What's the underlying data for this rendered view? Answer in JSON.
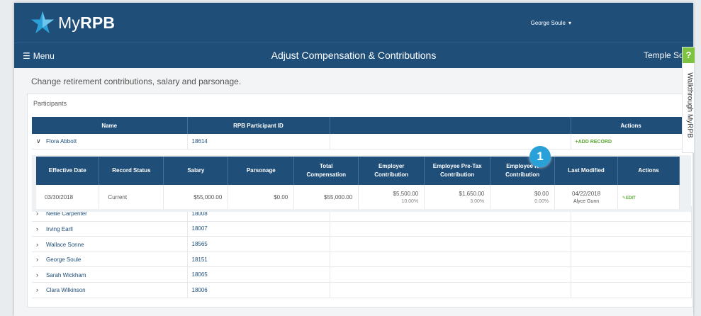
{
  "app": {
    "logo_my": "My",
    "logo_rpb": "RPB"
  },
  "user": {
    "name": "George Soule",
    "caret": "▾"
  },
  "nav": {
    "menu_icon": "☰",
    "menu_label": "Menu",
    "page_title": "Adjust Compensation & Contributions",
    "org": "Temple Solom"
  },
  "page": {
    "subtitle": "Change retirement contributions, salary and parsonage.",
    "panel_label": "Participants"
  },
  "colors": {
    "header_navy": "#1f4e79",
    "accent_green": "#5aa832",
    "badge_blue": "#2aa0d8",
    "walkthrough_green": "#7ec242"
  },
  "table": {
    "headers": {
      "name": "Name",
      "id": "RPB Participant ID",
      "blank": "",
      "actions": "Actions"
    },
    "expanded": {
      "name": "Flora Abbott",
      "id": "18614",
      "add_record": "+ADD RECORD",
      "expander": "∨"
    },
    "rows": [
      {
        "name": "Nellie Carpenter",
        "id": "18008",
        "expander": "›"
      },
      {
        "name": "Irving Earll",
        "id": "18007",
        "expander": "›"
      },
      {
        "name": "Wallace Sonne",
        "id": "18565",
        "expander": "›"
      },
      {
        "name": "George Soule",
        "id": "18151",
        "expander": "›"
      },
      {
        "name": "Sarah Wickham",
        "id": "18065",
        "expander": "›"
      },
      {
        "name": "Clara Wilkinson",
        "id": "18006",
        "expander": "›"
      }
    ]
  },
  "records": {
    "headers": {
      "effective_date": "Effective Date",
      "record_status": "Record Status",
      "salary": "Salary",
      "parsonage": "Parsonage",
      "total_comp_1": "Total",
      "total_comp_2": "Compensation",
      "employer_1": "Employer",
      "employer_2": "Contribution",
      "pretax_1": "Employee Pre-Tax",
      "pretax_2": "Contribution",
      "roth_1": "Employee R",
      "roth_2": "Contribution",
      "last_modified": "Last Modified",
      "actions": "Actions"
    },
    "row": {
      "effective_date": "03/30/2018",
      "status": "Current",
      "salary": "$55,000.00",
      "parsonage": "$0.00",
      "total": "$55,000.00",
      "employer": "$5,500.00",
      "employer_pct": "10.00%",
      "pretax": "$1,650.00",
      "pretax_pct": "3.00%",
      "roth": "$0.00",
      "roth_pct": "0.00%",
      "modified_date": "04/22/2018",
      "modified_by": "Alyce Gunn",
      "edit": "✎EDIT"
    }
  },
  "badge": {
    "number": "1"
  },
  "walkthrough": {
    "q": "?",
    "label": "Walkthrough MyRPB"
  }
}
